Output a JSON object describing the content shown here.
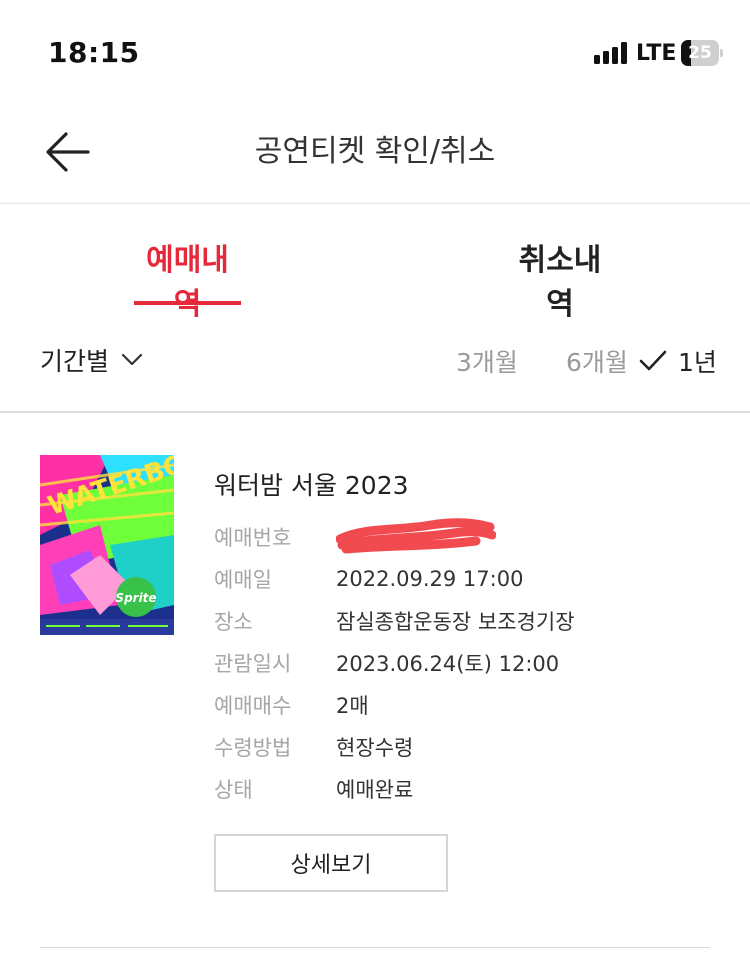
{
  "status_bar": {
    "time": "18:15",
    "network": "LTE",
    "battery_percent": "25",
    "battery_level": 0.25
  },
  "header": {
    "title": "공연티켓 확인/취소",
    "back_icon": "arrow-left-icon"
  },
  "tabs": [
    {
      "label": "예매내역",
      "active": true
    },
    {
      "label": "취소내역",
      "active": false
    }
  ],
  "filter": {
    "period_label": "기간별",
    "chevron_icon": "chevron-down-icon",
    "options": [
      {
        "label": "3개월",
        "selected": false
      },
      {
        "label": "6개월",
        "selected": false
      },
      {
        "label": "1년",
        "selected": true
      }
    ],
    "check_icon": "checkmark-icon"
  },
  "booking": {
    "title": "워터밤 서울 2023",
    "poster_text": "Sprite",
    "fields": [
      {
        "label": "예매번호",
        "value": "",
        "redacted": true
      },
      {
        "label": "예매일",
        "value": "2022.09.29 17:00"
      },
      {
        "label": "장소",
        "value": "잠실종합운동장 보조경기장"
      },
      {
        "label": "관람일시",
        "value": "2023.06.24(토) 12:00"
      },
      {
        "label": "예매매수",
        "value": "2매"
      },
      {
        "label": "수령방법",
        "value": "현장수령"
      },
      {
        "label": "상태",
        "value": "예매완료"
      }
    ],
    "detail_button": "상세보기"
  },
  "colors": {
    "accent": "#e5283a",
    "redaction": "#f0373d",
    "muted_text": "#a6a6a6"
  }
}
